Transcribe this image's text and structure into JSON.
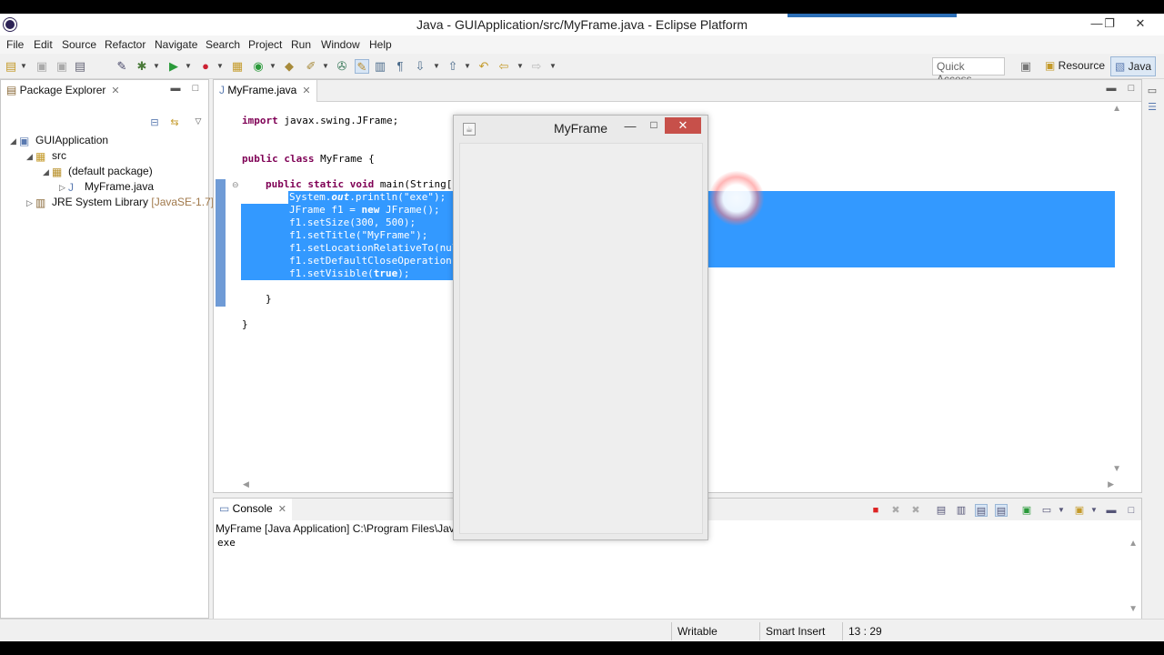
{
  "window": {
    "title": "Java - GUIApplication/src/MyFrame.java - Eclipse Platform",
    "controls": {
      "minimize": "—",
      "restore": "❐",
      "close": "✕"
    }
  },
  "menu": [
    "File",
    "Edit",
    "Source",
    "Refactor",
    "Navigate",
    "Search",
    "Project",
    "Run",
    "Window",
    "Help"
  ],
  "toolbar": {
    "quick_access_placeholder": "Quick Access",
    "perspectives": {
      "resource": "Resource",
      "java": "Java"
    }
  },
  "package_explorer": {
    "tab_label": "Package Explorer",
    "tree": {
      "project": "GUIApplication",
      "src": "src",
      "package": "(default package)",
      "file": "MyFrame.java",
      "library": "JRE System Library",
      "library_tag": "[JavaSE-1.7]"
    }
  },
  "editor": {
    "tab_label": "MyFrame.java",
    "code": {
      "import_kw": "import",
      "import_rest": " javax.swing.JFrame;",
      "class_kw": "public class",
      "class_rest": " MyFrame {",
      "main_kw": "public static void",
      "main_rest": " main(String[]",
      "l1_a": "System.",
      "l1_field": "out",
      "l1_b": ".println(",
      "l1_str": "\"exe\"",
      "l1_c": ");",
      "l2_a": "JFrame f1 = ",
      "l2_kw": "new",
      "l2_b": " JFrame();",
      "l3": "f1.setSize(300, 500);",
      "l4_a": "f1.setTitle(",
      "l4_str": "\"MyFrame\"",
      "l4_b": ");",
      "l5": "f1.setLocationRelativeTo(nul",
      "l6": "f1.setDefaultCloseOperation(",
      "l7_a": "f1.setVisible(",
      "l7_kw": "true",
      "l7_b": ");",
      "close_inner": "}",
      "close_outer": "}"
    }
  },
  "console": {
    "tab_label": "Console",
    "description": "MyFrame [Java Application] C:\\Program Files\\Java\\jre",
    "output": "exe"
  },
  "status": {
    "writable": "Writable",
    "insert_mode": "Smart Insert",
    "position": "13 : 29"
  },
  "myframe": {
    "title": "MyFrame",
    "minimize": "—",
    "maximize": "□",
    "close": "✕"
  },
  "colors": {
    "selection": "#3399ff",
    "keyword": "#7f0055",
    "string": "#2a00ff",
    "close_button": "#c7504a"
  }
}
